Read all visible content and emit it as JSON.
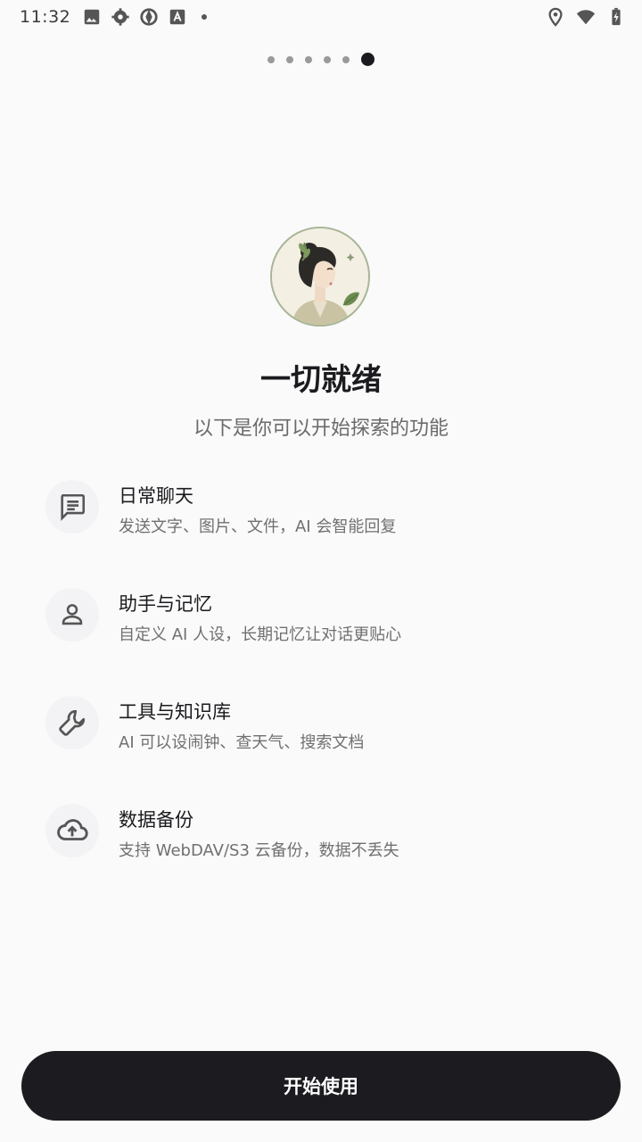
{
  "status_bar": {
    "time": "11:32",
    "left_icons": [
      "image-icon",
      "settings-icon",
      "vpn-icon",
      "font-icon",
      "notification-dot-icon"
    ],
    "right_icons": [
      "location-icon",
      "wifi-icon",
      "battery-charging-icon"
    ]
  },
  "pager": {
    "count": 6,
    "active_index": 5
  },
  "header": {
    "title": "一切就绪",
    "subtitle": "以下是你可以开始探索的功能"
  },
  "features": [
    {
      "icon": "chat-icon",
      "title": "日常聊天",
      "desc": "发送文字、图片、文件，AI 会智能回复"
    },
    {
      "icon": "person-icon",
      "title": "助手与记忆",
      "desc": "自定义 AI 人设，长期记忆让对话更贴心"
    },
    {
      "icon": "wrench-icon",
      "title": "工具与知识库",
      "desc": "AI 可以设闹钟、查天气、搜索文档"
    },
    {
      "icon": "cloud-upload-icon",
      "title": "数据备份",
      "desc": "支持 WebDAV/S3 云备份，数据不丢失"
    }
  ],
  "button": {
    "label": "开始使用"
  },
  "colors": {
    "primary": "#1c1b1f",
    "background": "#fafafa",
    "avatar_border": "#a8b596"
  }
}
